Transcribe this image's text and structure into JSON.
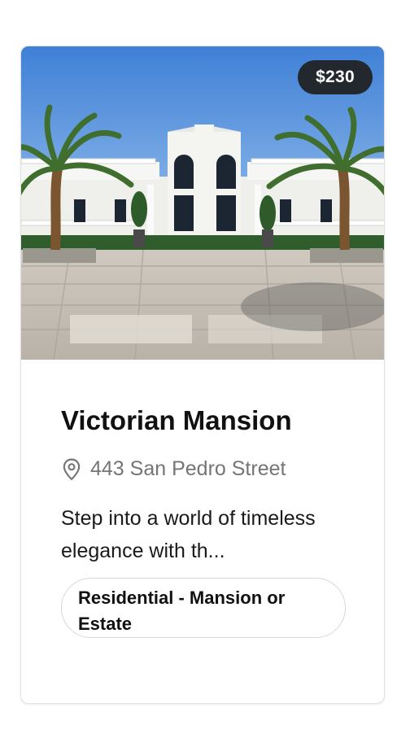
{
  "listing": {
    "price": "$230",
    "title": "Victorian Mansion",
    "address": "443 San Pedro Street",
    "description": "Step into a world of timeless elegance with th...",
    "category": "Residential - Mansion or Estate",
    "location_icon": "location-pin-icon"
  },
  "colors": {
    "price_badge_bg": "#22282e",
    "price_badge_text": "#ffffff",
    "address_text": "#757575",
    "tag_border": "#d8d8d8"
  }
}
